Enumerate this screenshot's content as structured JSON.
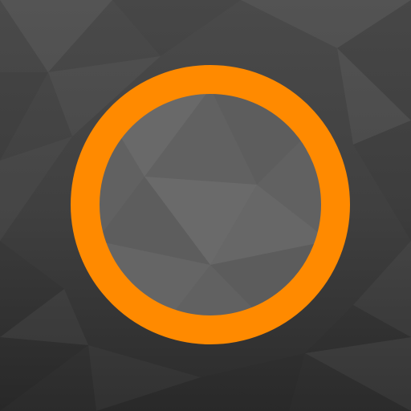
{
  "icon": {
    "name": "orange-ring-app-icon",
    "colors": {
      "background_dark": "#2b2b2b",
      "background_mid": "#404040",
      "background_light": "#4a4a4a",
      "ring": "#ff8a00",
      "inner_fill": "#616161",
      "inner_fill_light": "#6b6b6b"
    }
  }
}
